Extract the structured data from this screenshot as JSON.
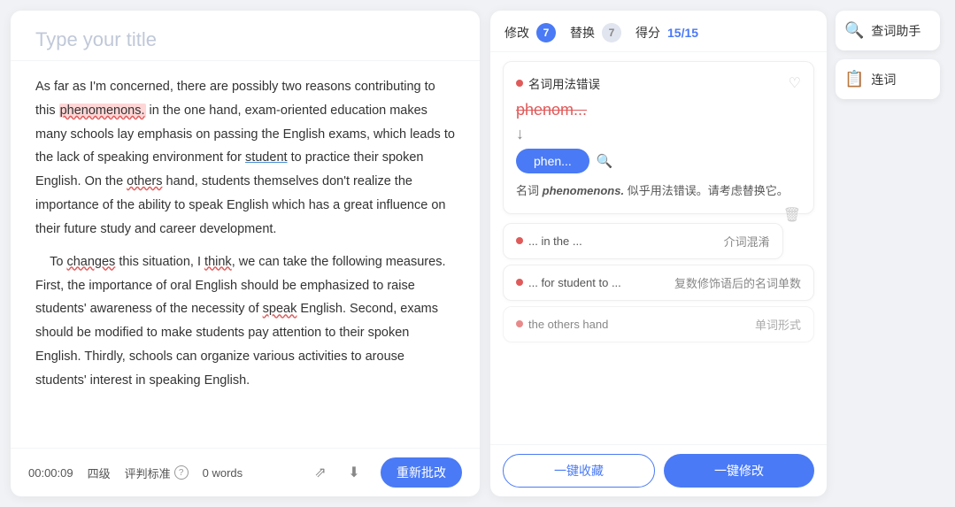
{
  "leftPanel": {
    "title": "Type your title",
    "content": {
      "paragraph1": "As far as I'm concerned, there are possibly two reasons contributing to this phenomenons. in the one hand, exam-oriented education makes many schools lay emphasis on passing the English exams, which leads to the lack of speaking environment for student to practice their spoken English. On the others hand, students themselves don't realize the importance of the ability to speak English which has a great influence on their future study and career development.",
      "paragraph2": "To changes this situation, I think, we can take the following measures. First, the importance of oral English should be emphasized to raise students' awareness of the necessity of speak English. Second, exams should be modified to make students pay attention to their spoken English. Thirdly, schools can organize various activities to arouse students' interest in speaking English."
    },
    "footer": {
      "time": "00:00:09",
      "level": "四级",
      "standard": "评判标准",
      "words": "0 words",
      "recheckBtn": "重新批改"
    }
  },
  "middlePanel": {
    "header": {
      "tab1": "修改",
      "tab1Badge": "7",
      "tab2": "替换",
      "tab2Badge": "7",
      "scoreLabel": "得分",
      "scoreValue": "15/15"
    },
    "mainError": {
      "dot": "•",
      "title": "名词用法错误",
      "wrongWord": "phenom...",
      "correctionText": "phen...",
      "description": "名词 phenomenons. 似乎用法错误。请考虑替换它。"
    },
    "minorErrors": [
      {
        "context": "... in the ...",
        "type": "介词混淆"
      },
      {
        "context": "... for student to ...",
        "type": "复数修饰语后的名词单数"
      },
      {
        "context": "the others hand",
        "type": "单词形式"
      }
    ],
    "footer": {
      "collectBtn": "一键收藏",
      "fixBtn": "一键修改"
    }
  },
  "rightPanel": {
    "btn1": "查词助手",
    "btn2": "连词"
  }
}
